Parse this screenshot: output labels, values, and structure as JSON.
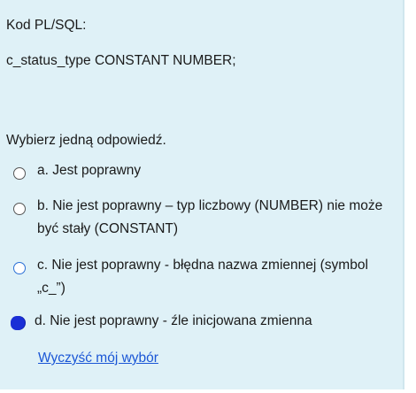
{
  "question": {
    "header": "Kod  PL/SQL:",
    "code": "c_status_type CONSTANT NUMBER;",
    "prompt": "Wybierz jedną odpowiedź."
  },
  "options": [
    {
      "text": "a. Jest poprawny",
      "selected": false
    },
    {
      "text": "b. Nie jest poprawny – typ liczbowy (NUMBER) nie może być stały (CONSTANT)",
      "selected": false
    },
    {
      "text": "c. Nie jest poprawny -  błędna nazwa zmiennej (symbol „c_”)",
      "selected": false
    },
    {
      "text": "d. Nie jest poprawny  - źle inicjowana zmienna",
      "selected": true
    }
  ],
  "clear_choice_label": "Wyczyść mój wybór",
  "colors": {
    "panel_background": "#dff1f7",
    "link": "#1a56d6",
    "selected_radio": "#1a2fd6"
  }
}
